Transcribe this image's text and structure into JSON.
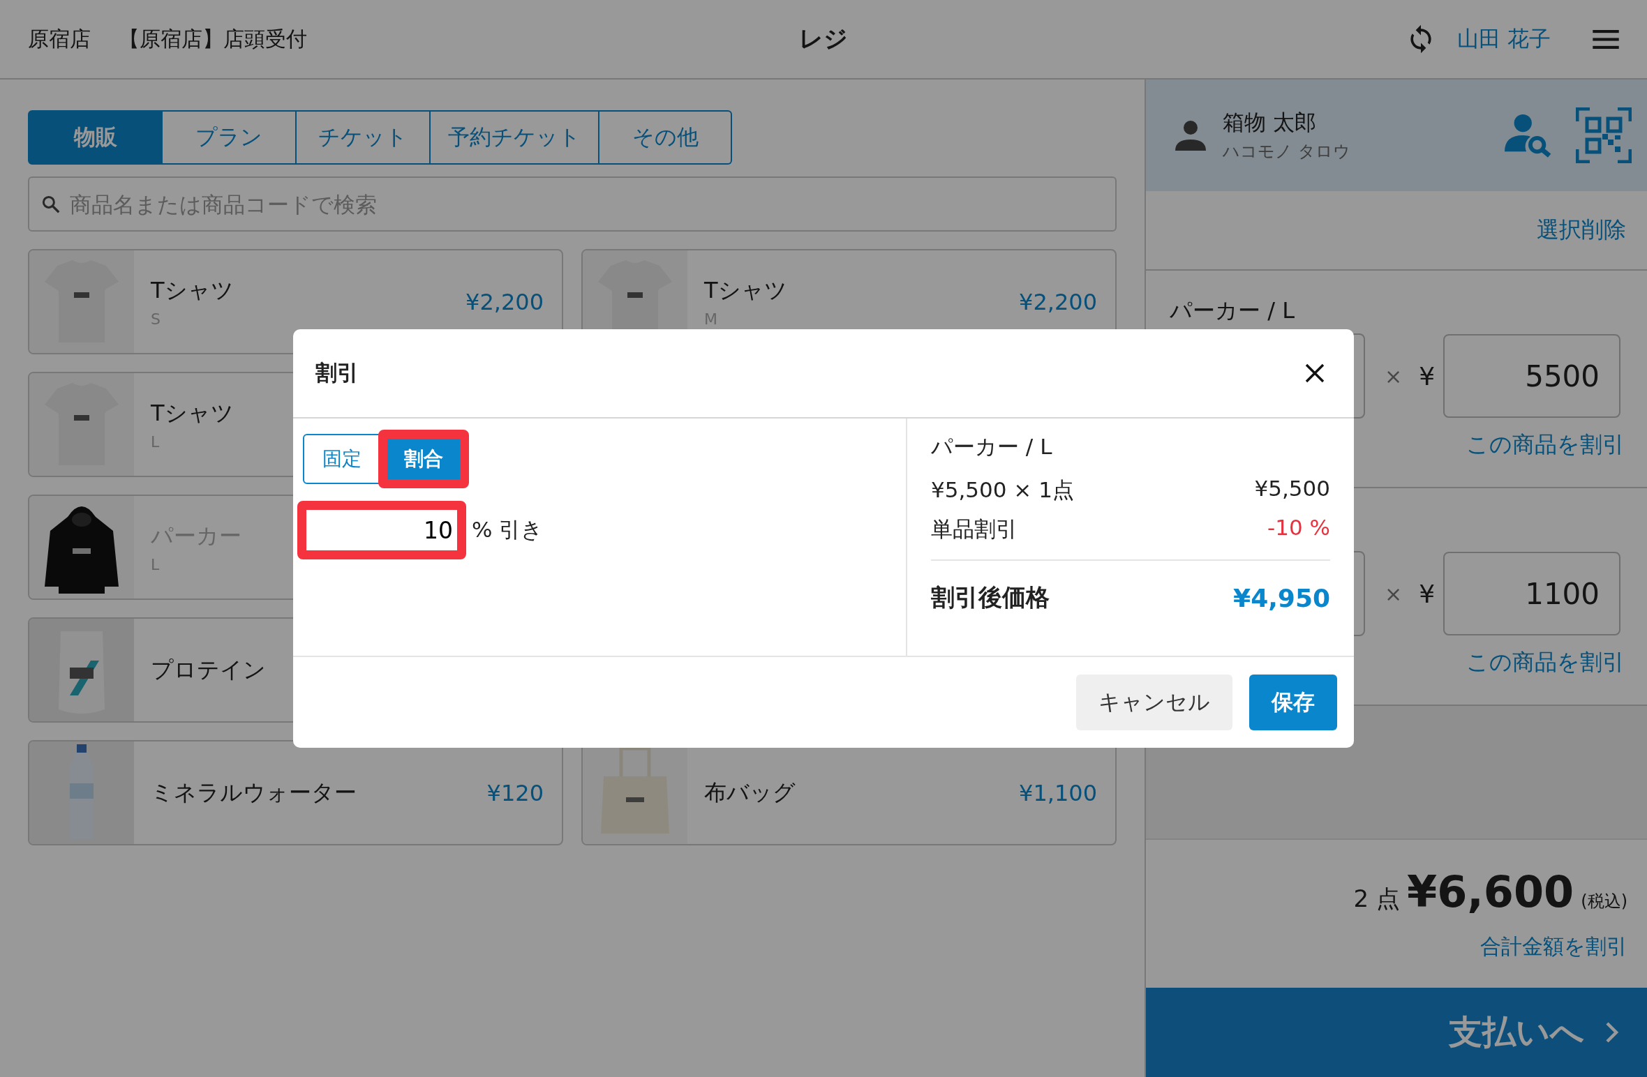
{
  "header": {
    "store": "原宿店",
    "register": "【原宿店】店頭受付",
    "title": "レジ",
    "staff": "山田 花子"
  },
  "category_tabs": [
    {
      "label": "物販",
      "selected": true
    },
    {
      "label": "プラン",
      "selected": false
    },
    {
      "label": "チケット",
      "selected": false
    },
    {
      "label": "予約チケット",
      "selected": false
    },
    {
      "label": "その他",
      "selected": false
    }
  ],
  "search": {
    "placeholder": "商品名または商品コードで検索"
  },
  "product_rows": [
    [
      {
        "name": "Tシャツ",
        "variant": "S",
        "price": "¥2,200",
        "disabled": false
      },
      {
        "name": "Tシャツ",
        "variant": "M",
        "price": "¥2,200",
        "disabled": false
      }
    ],
    [
      {
        "name": "Tシャツ",
        "variant": "L",
        "disabled": false
      }
    ],
    [
      {
        "name": "パーカー",
        "variant": "L",
        "disabled": true
      }
    ],
    [
      {
        "name": "プロテイン",
        "disabled": false
      }
    ],
    [
      {
        "name": "ミネラルウォーター",
        "price": "¥120",
        "disabled": false
      },
      {
        "name": "布バッグ",
        "price": "¥1,100",
        "disabled": false
      }
    ]
  ],
  "customer": {
    "name": "箱物 太郎",
    "kana": "ハコモノ タロウ"
  },
  "cart": {
    "clear_label": "選択削除",
    "items": [
      {
        "name": "パーカー / L",
        "times": "×",
        "currency": "¥",
        "price": "5500",
        "discount_label": "この商品を割引"
      },
      {
        "times": "×",
        "currency": "¥",
        "price": "1100",
        "discount_label": "この商品を割引"
      }
    ],
    "total": {
      "count": "2 点",
      "amount": "¥6,600",
      "tax_note": "(税込)",
      "discount_label": "合計金額を割引"
    },
    "pay_button": "支払いへ"
  },
  "modal": {
    "title": "割引",
    "modes": [
      {
        "label": "固定",
        "selected": false,
        "highlighted": false
      },
      {
        "label": "割合",
        "selected": true,
        "highlighted": true
      }
    ],
    "input": {
      "value": "10",
      "highlighted": true
    },
    "unit": "% 引き",
    "summary": {
      "item": "パーカー / L",
      "rows": [
        {
          "label": "¥5,500 × 1点",
          "value": "¥5,500",
          "kind": "price"
        },
        {
          "label": "単品割引",
          "value": "-10 %",
          "kind": "discount"
        }
      ],
      "result_label": "割引後価格",
      "result_value": "¥4,950"
    },
    "buttons": [
      {
        "label": "キャンセル",
        "kind": "secondary"
      },
      {
        "label": "保存",
        "kind": "primary"
      }
    ]
  }
}
